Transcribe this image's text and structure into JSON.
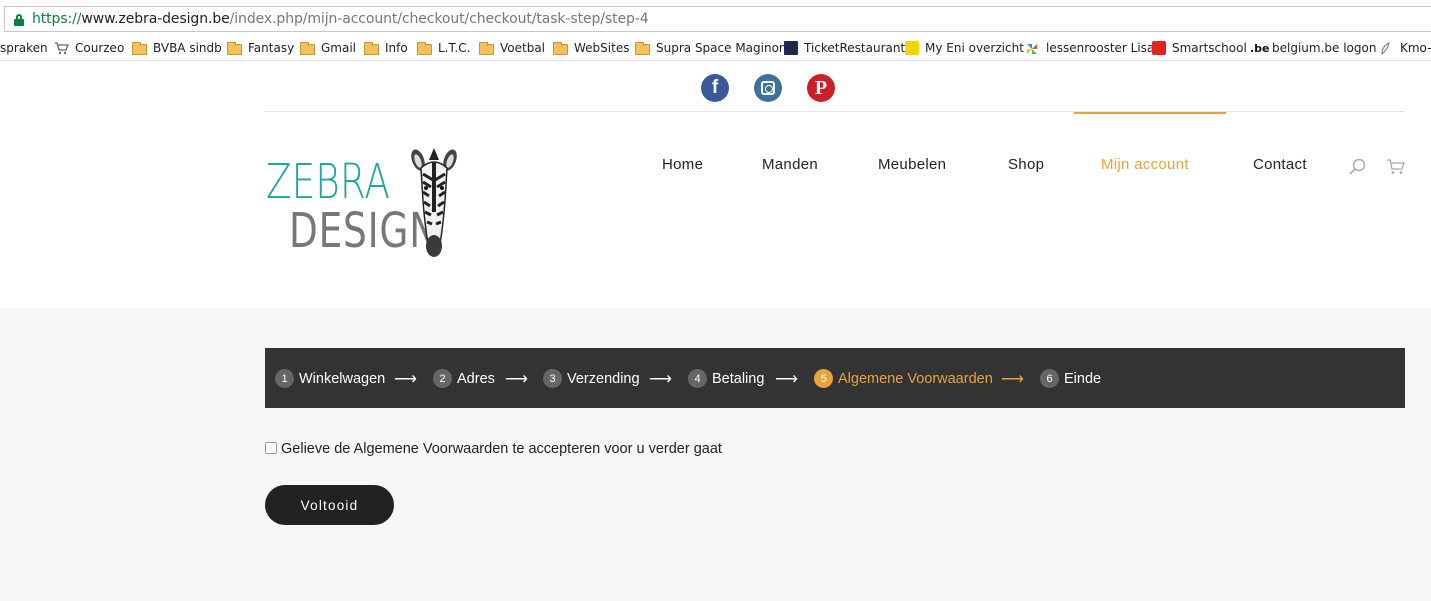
{
  "browser": {
    "url_scheme": "https://",
    "url_host": "www.zebra-design.be",
    "url_path": "/index.php/mijn-account/checkout/checkout/task-step/step-4",
    "bookmarks": [
      {
        "label": "spraken",
        "icon": "none"
      },
      {
        "label": "Courzeo",
        "icon": "cart-icon"
      },
      {
        "label": "BVBA sindb",
        "icon": "folder-icon"
      },
      {
        "label": "Fantasy",
        "icon": "folder-icon"
      },
      {
        "label": "Gmail",
        "icon": "folder-icon"
      },
      {
        "label": "Info",
        "icon": "folder-icon"
      },
      {
        "label": "L.T.C.",
        "icon": "folder-icon"
      },
      {
        "label": "Voetbal",
        "icon": "folder-icon"
      },
      {
        "label": "WebSites",
        "icon": "folder-icon"
      },
      {
        "label": "Supra Space Maginon",
        "icon": "folder-icon"
      },
      {
        "label": "TicketRestaurant",
        "icon": "ticket-icon"
      },
      {
        "label": "My Eni overzicht",
        "icon": "eni-icon"
      },
      {
        "label": "lessenrooster Lisa",
        "icon": "pinwheel-icon"
      },
      {
        "label": "Smartschool",
        "icon": "smartschool-icon"
      },
      {
        "label": "belgium.be logon",
        "icon": "be-icon"
      },
      {
        "label": "Kmo-p",
        "icon": "leaf-icon"
      }
    ]
  },
  "social": {
    "facebook": "f",
    "pinterest": "P"
  },
  "logo": {
    "line1": "ZEBRA",
    "line2": "DESIGN"
  },
  "nav": {
    "items": [
      "Home",
      "Manden",
      "Meubelen",
      "Shop",
      "Mijn account",
      "Contact"
    ],
    "active": "Mijn account"
  },
  "checkout": {
    "steps": [
      {
        "num": "1",
        "label": "Winkelwagen"
      },
      {
        "num": "2",
        "label": "Adres"
      },
      {
        "num": "3",
        "label": "Verzending"
      },
      {
        "num": "4",
        "label": "Betaling"
      },
      {
        "num": "5",
        "label": "Algemene Voorwaarden"
      },
      {
        "num": "6",
        "label": "Einde"
      }
    ],
    "current_step": 5,
    "arrow": "⟶",
    "terms_label": "Gelieve de Algemene Voorwaarden te accepteren voor u verder gaat",
    "terms_checked": false,
    "submit_label": "Voltooid"
  },
  "colors": {
    "accent": "#e8a33d",
    "steps_bar": "#333333",
    "logo_teal": "#1fa6a0",
    "button": "#222222"
  }
}
